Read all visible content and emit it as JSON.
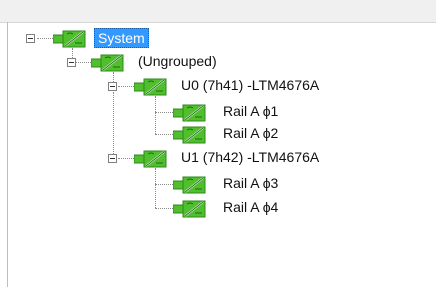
{
  "tree": {
    "root": {
      "label": "System",
      "selected": true,
      "icon": "power-module-icon"
    },
    "group": {
      "label": "(Ungrouped)",
      "icon": "power-module-icon"
    },
    "devices": [
      {
        "label": "U0 (7h41) -LTM4676A",
        "icon": "power-module-icon",
        "rails": [
          "Rail A ϕ1",
          "Rail A ϕ2"
        ]
      },
      {
        "label": "U1 (7h42) -LTM4676A",
        "icon": "power-module-icon",
        "rails": [
          "Rail A ϕ3",
          "Rail A ϕ4"
        ]
      }
    ]
  },
  "colors": {
    "selection": "#3399ff",
    "icon_green": "#4fbf2d",
    "icon_dark_green": "#2f8a1a"
  }
}
